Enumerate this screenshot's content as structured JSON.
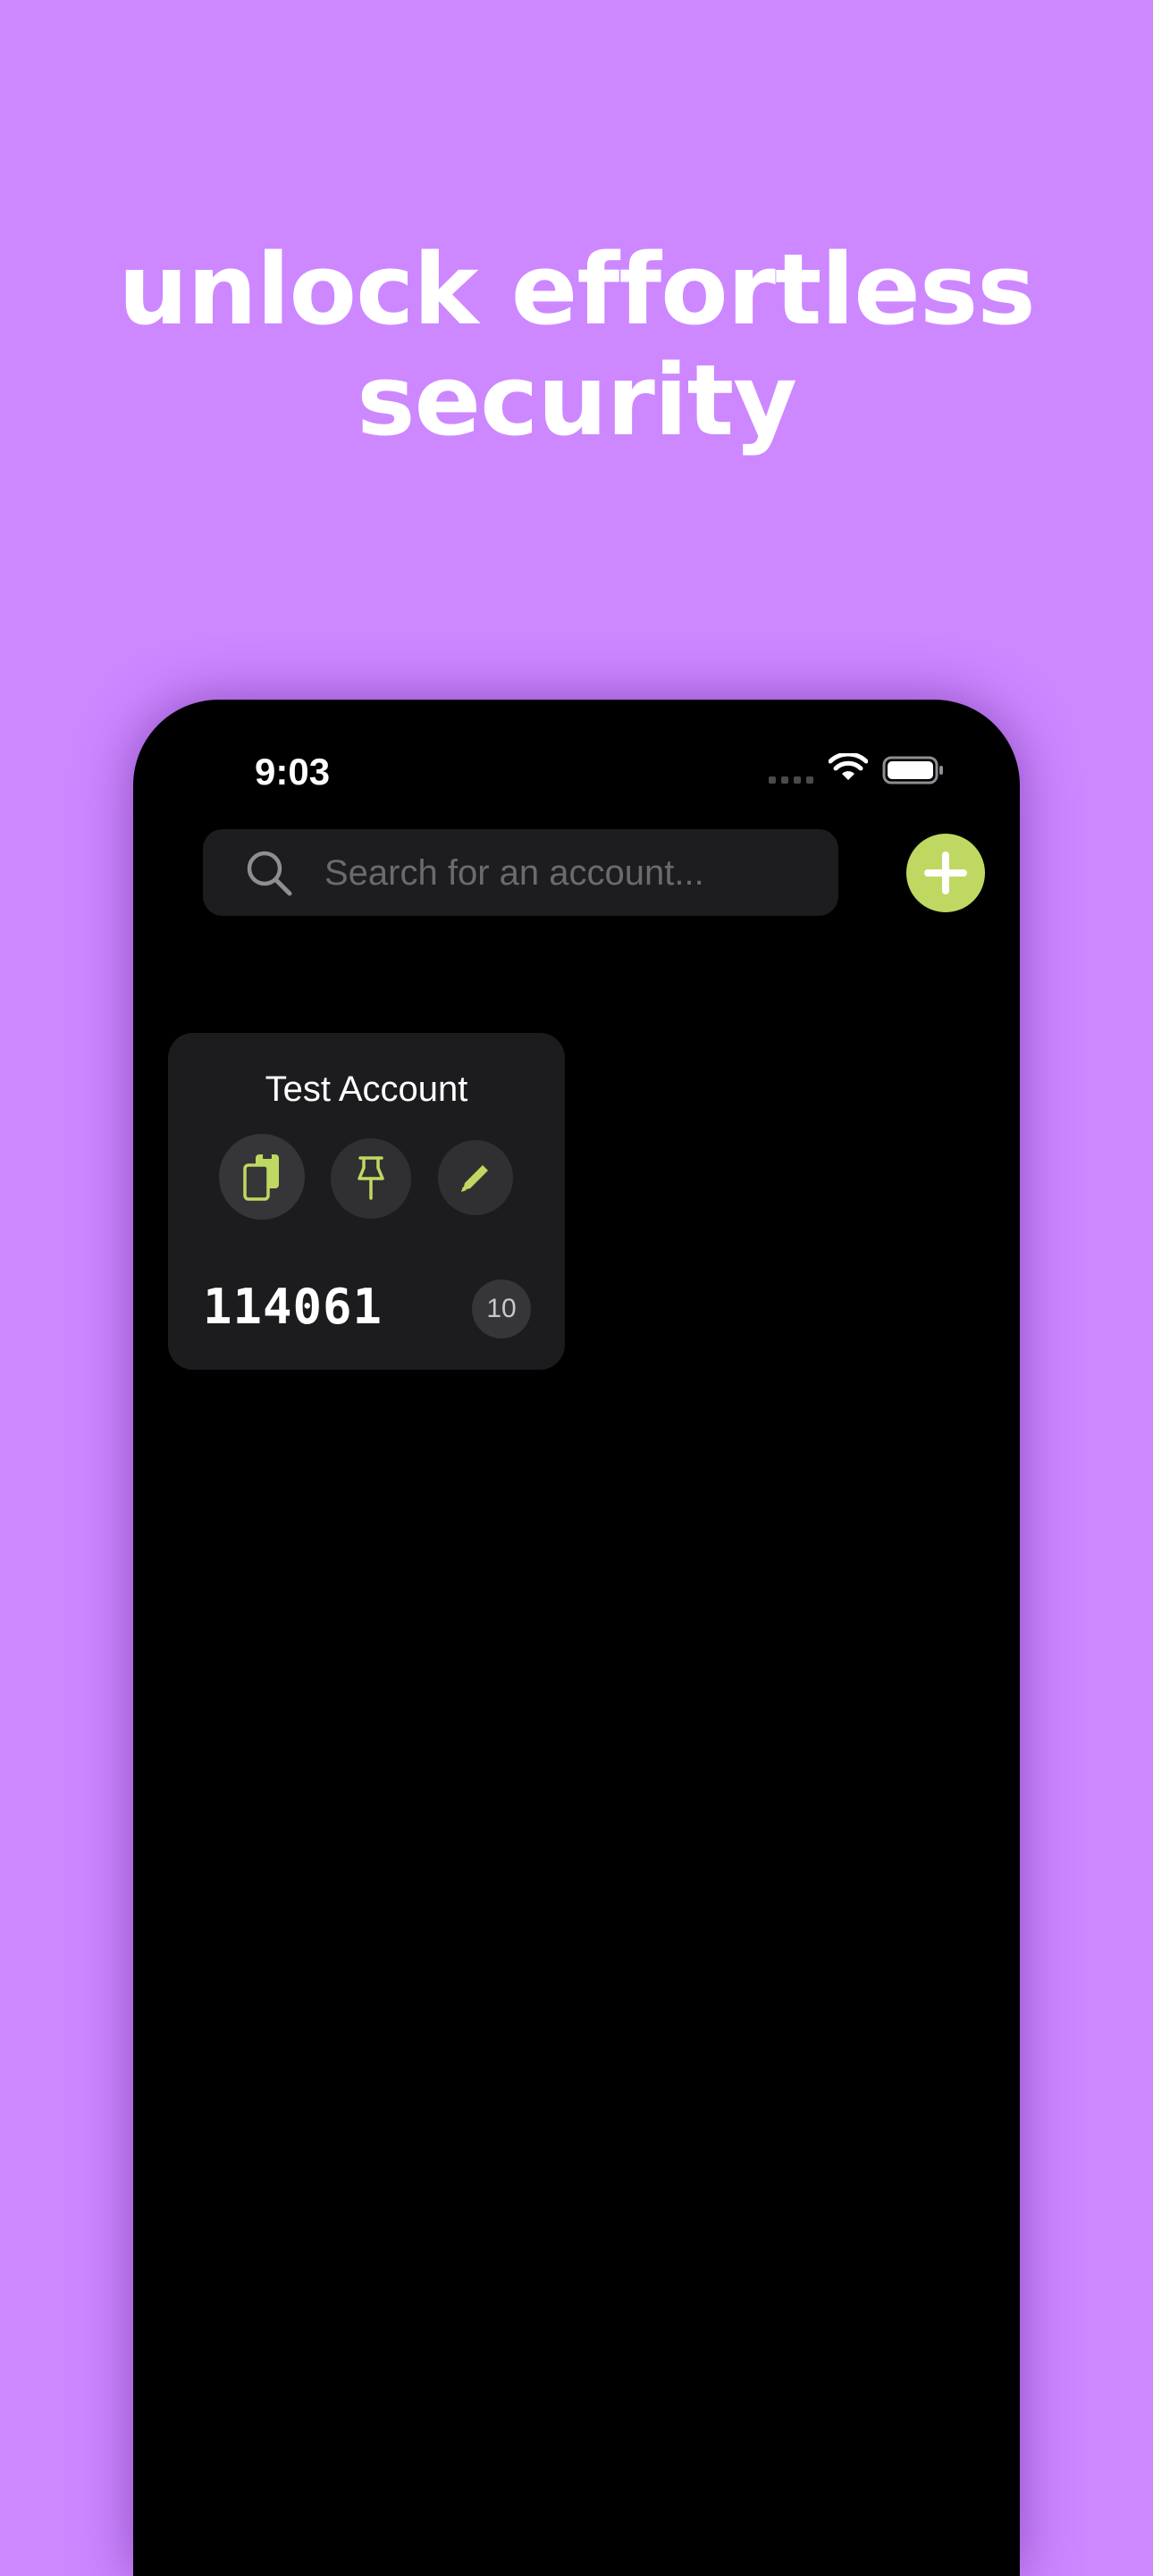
{
  "headline": {
    "line1": "unlock effortless",
    "line2": "security"
  },
  "status_bar": {
    "time": "9:03"
  },
  "search": {
    "placeholder": "Search for an account..."
  },
  "add_button": {
    "icon": "plus-icon"
  },
  "accounts": [
    {
      "title": "Test Account",
      "code": "114061",
      "seconds_left": "10",
      "actions": [
        "copy-icon",
        "pin-icon",
        "pencil-icon"
      ]
    }
  ],
  "colors": {
    "background": "#cd87ff",
    "accent": "#bfd862",
    "card": "#1c1c1e"
  }
}
